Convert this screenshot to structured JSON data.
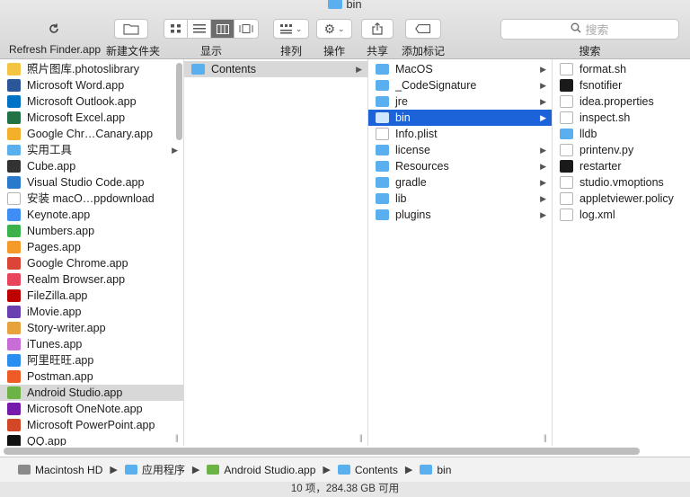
{
  "window": {
    "title": "bin"
  },
  "toolbar": {
    "refresh_label": "Refresh Finder.app",
    "new_folder_label": "新建文件夹",
    "view_label": "显示",
    "sort_label": "排列",
    "action_label": "操作",
    "share_label": "共享",
    "tag_label": "添加标记",
    "search_label": "搜索",
    "search_placeholder": "搜索"
  },
  "columns": {
    "col1": {
      "items": [
        {
          "label": "照片图库.photoslibrary",
          "icon": "photos-icon",
          "color": "#f4c542"
        },
        {
          "label": "Microsoft Word.app",
          "icon": "word-icon",
          "color": "#2b579a"
        },
        {
          "label": "Microsoft Outlook.app",
          "icon": "outlook-icon",
          "color": "#0072c6"
        },
        {
          "label": "Microsoft Excel.app",
          "icon": "excel-icon",
          "color": "#217346"
        },
        {
          "label": "Google Chr…Canary.app",
          "icon": "chrome-canary-icon",
          "color": "#f2b02b"
        },
        {
          "label": "实用工具",
          "icon": "folder-icon",
          "color": "#5ab0ef",
          "has_children": true
        },
        {
          "label": "Cube.app",
          "icon": "cube-icon",
          "color": "#333333"
        },
        {
          "label": "Visual Studio Code.app",
          "icon": "vscode-icon",
          "color": "#2a7acb"
        },
        {
          "label": "安装 macO…ppdownload",
          "icon": "document-icon",
          "color": "#ffffff"
        },
        {
          "label": "Keynote.app",
          "icon": "keynote-icon",
          "color": "#3f8ef4"
        },
        {
          "label": "Numbers.app",
          "icon": "numbers-icon",
          "color": "#3bb24a"
        },
        {
          "label": "Pages.app",
          "icon": "pages-icon",
          "color": "#f49a2b"
        },
        {
          "label": "Google Chrome.app",
          "icon": "chrome-icon",
          "color": "#db4437"
        },
        {
          "label": "Realm Browser.app",
          "icon": "realm-icon",
          "color": "#e9445b"
        },
        {
          "label": "FileZilla.app",
          "icon": "filezilla-icon",
          "color": "#bf0000"
        },
        {
          "label": "iMovie.app",
          "icon": "imovie-icon",
          "color": "#6a3fb0"
        },
        {
          "label": "Story-writer.app",
          "icon": "story-writer-icon",
          "color": "#e8a23c"
        },
        {
          "label": "iTunes.app",
          "icon": "itunes-icon",
          "color": "#c86dd7"
        },
        {
          "label": "阿里旺旺.app",
          "icon": "aliwangwang-icon",
          "color": "#2a8ef0"
        },
        {
          "label": "Postman.app",
          "icon": "postman-icon",
          "color": "#ef5b25"
        },
        {
          "label": "Android Studio.app",
          "icon": "android-studio-icon",
          "color": "#6ab344",
          "selected": true
        },
        {
          "label": "Microsoft OneNote.app",
          "icon": "onenote-icon",
          "color": "#7719aa"
        },
        {
          "label": "Microsoft PowerPoint.app",
          "icon": "powerpoint-icon",
          "color": "#d24726"
        },
        {
          "label": "QQ.app",
          "icon": "qq-icon",
          "color": "#111111"
        }
      ]
    },
    "col2": {
      "items": [
        {
          "label": "Contents",
          "selected": true
        }
      ]
    },
    "col3": {
      "items": [
        {
          "label": "MacOS",
          "type": "folder"
        },
        {
          "label": "_CodeSignature",
          "type": "folder"
        },
        {
          "label": "jre",
          "type": "folder"
        },
        {
          "label": "bin",
          "type": "folder",
          "selected": true
        },
        {
          "label": "Info.plist",
          "type": "file"
        },
        {
          "label": "license",
          "type": "folder"
        },
        {
          "label": "Resources",
          "type": "folder"
        },
        {
          "label": "gradle",
          "type": "folder"
        },
        {
          "label": "lib",
          "type": "folder"
        },
        {
          "label": "plugins",
          "type": "folder"
        }
      ]
    },
    "col4": {
      "items": [
        {
          "label": "format.sh",
          "type": "doc"
        },
        {
          "label": "fsnotifier",
          "type": "exec"
        },
        {
          "label": "idea.properties",
          "type": "doc"
        },
        {
          "label": "inspect.sh",
          "type": "doc"
        },
        {
          "label": "lldb",
          "type": "folder"
        },
        {
          "label": "printenv.py",
          "type": "doc"
        },
        {
          "label": "restarter",
          "type": "exec"
        },
        {
          "label": "studio.vmoptions",
          "type": "doc"
        },
        {
          "label": "appletviewer.policy",
          "type": "doc"
        },
        {
          "label": "log.xml",
          "type": "doc"
        }
      ]
    }
  },
  "pathbar": {
    "crumbs": [
      "Macintosh HD",
      "应用程序",
      "Android Studio.app",
      "Contents",
      "bin"
    ]
  },
  "status": {
    "text": "10 项，284.38 GB 可用"
  }
}
